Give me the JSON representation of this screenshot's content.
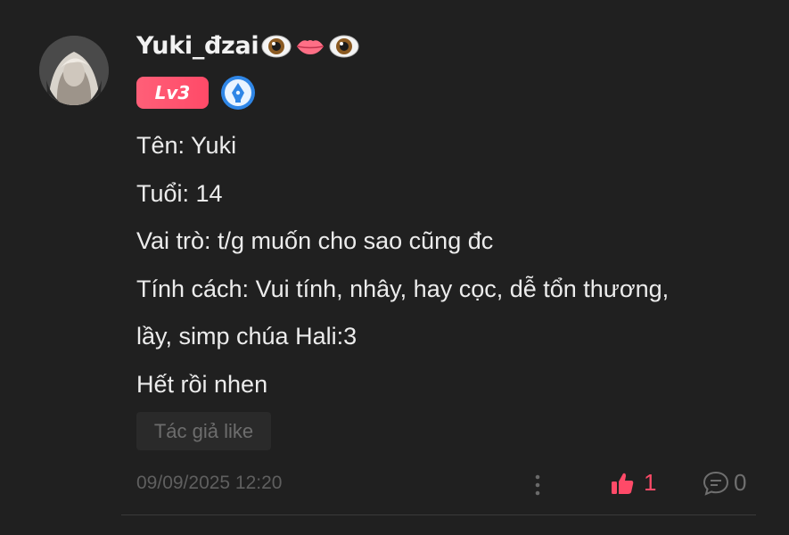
{
  "comment": {
    "username": "Yuki_đzai",
    "username_emojis": [
      "eye-emoji",
      "lips-emoji",
      "eye-emoji"
    ],
    "level_badge": "Lv3",
    "level_badge_color": "#ff4a68",
    "content_lines": [
      "Tên: Yuki",
      "Tuổi: 14",
      "Vai trò: t/g muốn cho sao cũng đc",
      "Tính cách: Vui tính, nhây, hay cọc, dễ tổn thương,",
      "lầy, simp chúa Hali:3",
      "Hết rồi nhen"
    ],
    "author_like_label": "Tác giả like",
    "timestamp": "09/09/2025 12:20",
    "like_count": "1",
    "reply_count": "0",
    "accent_color": "#ff4a68",
    "background_color": "#202020"
  }
}
